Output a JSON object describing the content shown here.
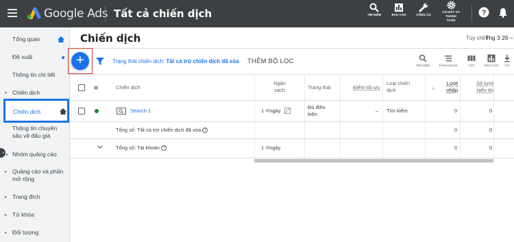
{
  "app": {
    "brand": "Google Ads",
    "title": "Tất cả chiến dịch"
  },
  "top_tools": [
    {
      "label": "TÌM KIẾM",
      "icon": "search-icon"
    },
    {
      "label": "BÁO CÁO",
      "icon": "reports-icon"
    },
    {
      "label": "CÔNG CỤ",
      "icon": "wrench-icon"
    },
    {
      "label_line1": "CÀI ĐẶT VÀ",
      "label_line2": "THANH",
      "label_line3": "TOÁN",
      "icon": "gear-icon"
    }
  ],
  "sidebar": {
    "items": [
      {
        "label": "Tổng quan"
      },
      {
        "label": "Đề xuất"
      },
      {
        "label": "Thông tin chi tiết"
      },
      {
        "label": "Chiến dịch"
      },
      {
        "label": "Chiến dịch"
      },
      {
        "label": "Thông tin chuyên",
        "label2": "sâu về đấu giá"
      },
      {
        "label": "Nhóm quảng cáo"
      },
      {
        "label": "Quảng cáo và phần",
        "label2": "mở rộng"
      },
      {
        "label": "Trang đích"
      },
      {
        "label": "Từ khóa"
      },
      {
        "label": "Đối tượng"
      }
    ]
  },
  "header": {
    "page_title": "Chiến dịch",
    "custom_label": "Tùy chỉnh",
    "date_range": "Thg 3 26 –"
  },
  "filter_bar": {
    "add_symbol": "+",
    "filter_prefix": "Trạng thái chiến dịch: ",
    "filter_value": "Tất cả trừ chiến dịch đã xóa",
    "add_filter": "THÊM BỘ LỌC",
    "toolbar": [
      {
        "label": "TÌM KIẾM",
        "icon": "search-icon"
      },
      {
        "label": "PHÂN ĐOẠN",
        "icon": "segment-icon"
      },
      {
        "label": "CỘT",
        "icon": "columns-icon"
      },
      {
        "label": "BÁO CÁO",
        "icon": "reports-icon"
      },
      {
        "label": "TẢI",
        "icon": "download-icon"
      }
    ]
  },
  "table": {
    "headers": {
      "campaign": "Chiến dịch",
      "budget_l1": "Ngân",
      "budget_l2": "sách",
      "status": "Trạng thái",
      "opt_score": "Điểm tối ưu",
      "type_l1": "Loại chiến",
      "type_l2": "dịch",
      "clicks_l1": "Lượt",
      "clicks_l2": "nhấp",
      "impr_l1": "Số lượt",
      "impr_l2": "hiển thị",
      "sort_arrow": "↓"
    },
    "rows": [
      {
        "name": "Search-1",
        "budget": "1 ₫/ngày",
        "status_l1": "Đủ điều",
        "status_l2": "kiện",
        "opt_score": "–",
        "type": "Tìm kiếm",
        "clicks": "0",
        "impressions": "0",
        "status_color": "#188038"
      }
    ],
    "totals": [
      {
        "label": "Tổng số: Tất cả trừ chiến dịch đã xóa",
        "budget": "",
        "clicks": "0",
        "impressions": "0"
      },
      {
        "label": "Tổng số: Tài khoản",
        "budget": "1 ₫/ngày",
        "clicks": "0",
        "impressions": "0"
      }
    ]
  },
  "colors": {
    "accent": "#1a73e8",
    "highlight_red": "#d93025",
    "topbar": "#3c4043"
  }
}
